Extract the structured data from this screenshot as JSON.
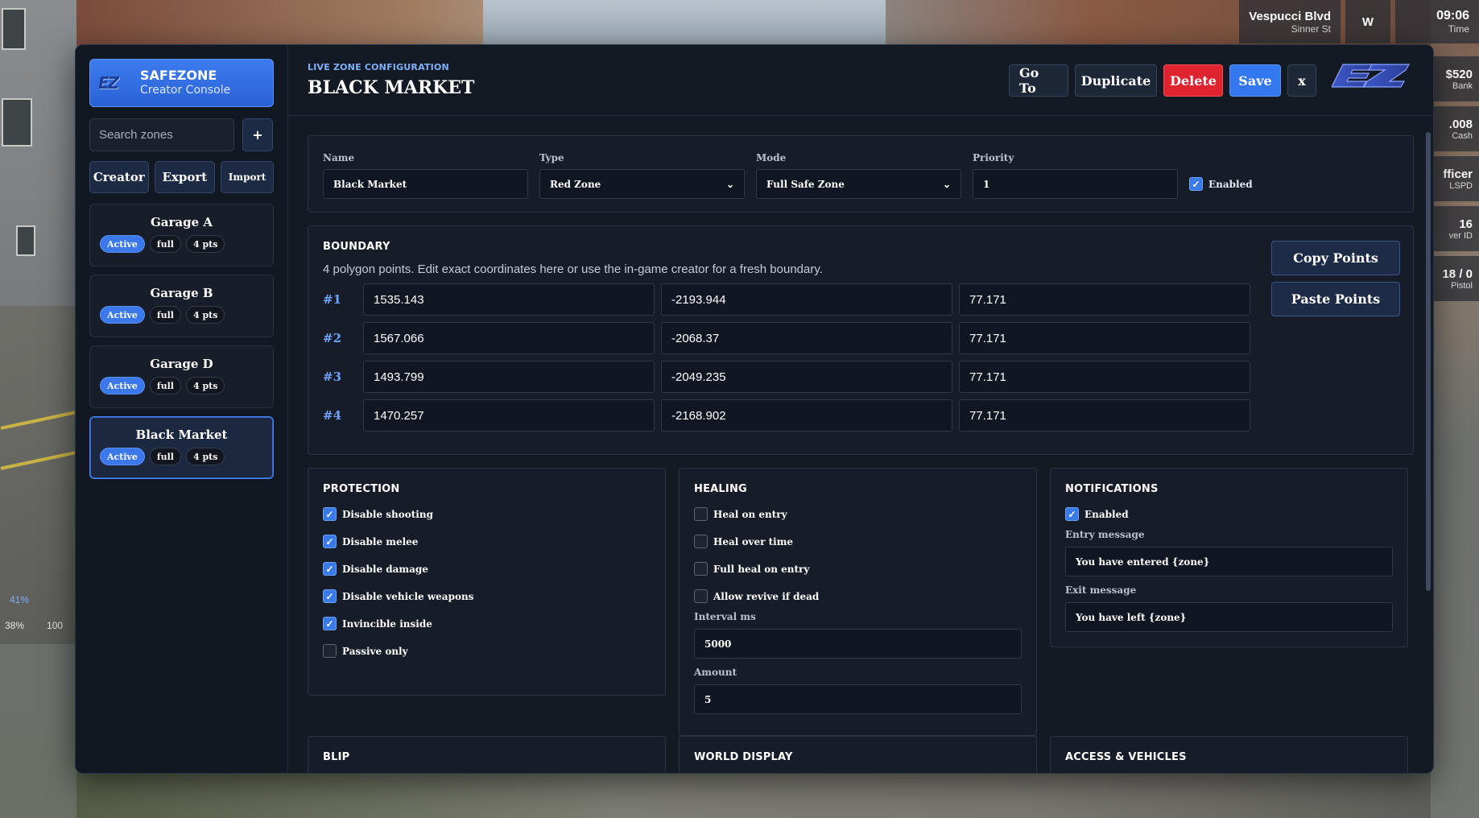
{
  "hud": {
    "street": "Vespucci Blvd",
    "substreet": "Sinner St",
    "compass": "W",
    "time": "09:06",
    "time_label": "Time",
    "side": [
      {
        "value": "$520",
        "label": "Bank"
      },
      {
        "value": ".008",
        "label": "Cash"
      },
      {
        "value": "fficer",
        "label": "LSPD"
      },
      {
        "value": "16",
        "label": "ver ID"
      },
      {
        "value": "18 / 0",
        "label": "Pistol"
      }
    ],
    "stats": [
      "41%",
      "38%",
      "100"
    ]
  },
  "sidebar": {
    "brand_title": "SAFEZONE",
    "brand_sub": "Creator Console",
    "logo_text": "EZ",
    "search_placeholder": "Search zones",
    "add_label": "+",
    "tools": [
      "Creator",
      "Export",
      "Import"
    ],
    "zones": [
      {
        "name": "Garage A",
        "status": "Active",
        "mode": "full",
        "points": "4 pts"
      },
      {
        "name": "Garage B",
        "status": "Active",
        "mode": "full",
        "points": "4 pts"
      },
      {
        "name": "Garage D",
        "status": "Active",
        "mode": "full",
        "points": "4 pts"
      },
      {
        "name": "Black Market",
        "status": "Active",
        "mode": "full",
        "points": "4 pts"
      }
    ]
  },
  "header": {
    "eyebrow": "LIVE ZONE CONFIGURATION",
    "title": "BLACK MARKET",
    "actions": {
      "goto": "Go To",
      "duplicate": "Duplicate",
      "delete": "Delete",
      "save": "Save",
      "close": "x"
    }
  },
  "config": {
    "name_label": "Name",
    "name_value": "Black Market",
    "type_label": "Type",
    "type_value": "Red Zone",
    "mode_label": "Mode",
    "mode_value": "Full Safe Zone",
    "priority_label": "Priority",
    "priority_value": "1",
    "enabled_label": "Enabled",
    "enabled": true
  },
  "boundary": {
    "title": "BOUNDARY",
    "description": "4 polygon points. Edit exact coordinates here or use the in-game creator for a fresh boundary.",
    "copy_label": "Copy Points",
    "paste_label": "Paste Points",
    "points": [
      {
        "idx": "#1",
        "x": "1535.143",
        "y": "-2193.944",
        "z": "77.171"
      },
      {
        "idx": "#2",
        "x": "1567.066",
        "y": "-2068.37",
        "z": "77.171"
      },
      {
        "idx": "#3",
        "x": "1493.799",
        "y": "-2049.235",
        "z": "77.171"
      },
      {
        "idx": "#4",
        "x": "1470.257",
        "y": "-2168.902",
        "z": "77.171"
      }
    ]
  },
  "protection": {
    "title": "PROTECTION",
    "options": [
      {
        "label": "Disable shooting",
        "checked": true
      },
      {
        "label": "Disable melee",
        "checked": true
      },
      {
        "label": "Disable damage",
        "checked": true
      },
      {
        "label": "Disable vehicle weapons",
        "checked": true
      },
      {
        "label": "Invincible inside",
        "checked": true
      },
      {
        "label": "Passive only",
        "checked": false
      }
    ]
  },
  "healing": {
    "title": "HEALING",
    "options": [
      {
        "label": "Heal on entry",
        "checked": false
      },
      {
        "label": "Heal over time",
        "checked": false
      },
      {
        "label": "Full heal on entry",
        "checked": false
      },
      {
        "label": "Allow revive if dead",
        "checked": false
      }
    ],
    "interval_label": "Interval ms",
    "interval_value": "5000",
    "amount_label": "Amount",
    "amount_value": "5"
  },
  "notifications": {
    "title": "NOTIFICATIONS",
    "enabled_label": "Enabled",
    "enabled": true,
    "entry_label": "Entry message",
    "entry_value": "You have entered {zone}",
    "exit_label": "Exit message",
    "exit_value": "You have left {zone}"
  },
  "lower_sections": [
    "BLIP",
    "WORLD DISPLAY",
    "ACCESS & VEHICLES"
  ],
  "colors": {
    "accent": "#3a7ae8",
    "danger": "#df2430",
    "panel": "#141a24"
  }
}
